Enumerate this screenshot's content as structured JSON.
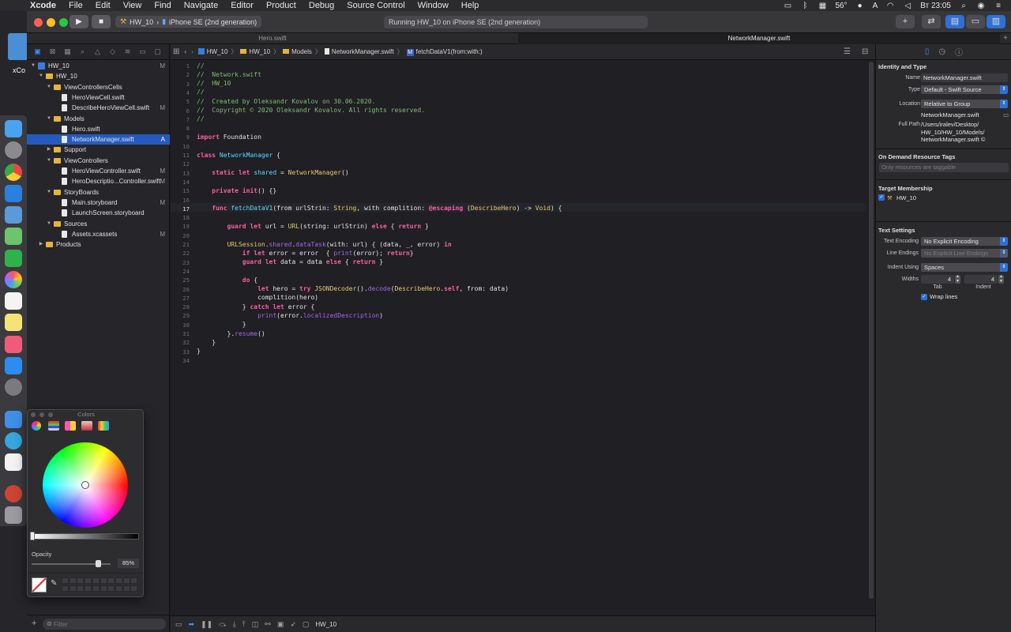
{
  "menubar": {
    "apple": "",
    "items": [
      "Xcode",
      "File",
      "Edit",
      "View",
      "Find",
      "Navigate",
      "Editor",
      "Product",
      "Debug",
      "Source Control",
      "Window",
      "Help"
    ],
    "status": {
      "temperature": "56°",
      "input": "A",
      "clock": "Вт 23:05"
    }
  },
  "desktop": {
    "label": "xCo"
  },
  "toolbar": {
    "run": "▶",
    "stop": "■",
    "scheme_target": "HW_10",
    "scheme_device": "iPhone SE (2nd generation)",
    "activity": "Running HW_10 on iPhone SE (2nd generation)",
    "library": "+",
    "code_review": "⇄"
  },
  "tabs": [
    {
      "label": "Hero.swift",
      "active": false
    },
    {
      "label": "NetworkManager.swift",
      "active": true
    }
  ],
  "navigator": {
    "tree": [
      {
        "label": "HW_10",
        "depth": 0,
        "kind": "proj",
        "open": true,
        "flag": "M"
      },
      {
        "label": "HW_10",
        "depth": 1,
        "kind": "folder",
        "open": true,
        "flag": ""
      },
      {
        "label": "ViewControllersCells",
        "depth": 2,
        "kind": "folder",
        "open": true,
        "flag": ""
      },
      {
        "label": "HeroViewCell.swift",
        "depth": 3,
        "kind": "file",
        "flag": ""
      },
      {
        "label": "DescribeHeroViewCell.swift",
        "depth": 3,
        "kind": "file",
        "flag": "M"
      },
      {
        "label": "Models",
        "depth": 2,
        "kind": "folder",
        "open": true,
        "flag": ""
      },
      {
        "label": "Hero.swift",
        "depth": 3,
        "kind": "file",
        "flag": ""
      },
      {
        "label": "NetworkManager.swift",
        "depth": 3,
        "kind": "file",
        "flag": "A",
        "selected": true
      },
      {
        "label": "Support",
        "depth": 2,
        "kind": "folder",
        "open": false,
        "flag": ""
      },
      {
        "label": "ViewControllers",
        "depth": 2,
        "kind": "folder",
        "open": true,
        "flag": ""
      },
      {
        "label": "HeroViewController.swift",
        "depth": 3,
        "kind": "file",
        "flag": "M"
      },
      {
        "label": "HeroDescriptio...Controller.swift",
        "depth": 3,
        "kind": "file",
        "flag": "M"
      },
      {
        "label": "StoryBoards",
        "depth": 2,
        "kind": "folder",
        "open": true,
        "flag": ""
      },
      {
        "label": "Main.storyboard",
        "depth": 3,
        "kind": "file",
        "flag": "M"
      },
      {
        "label": "LaunchScreen.storyboard",
        "depth": 3,
        "kind": "file",
        "flag": ""
      },
      {
        "label": "Sources",
        "depth": 2,
        "kind": "folder",
        "open": true,
        "flag": ""
      },
      {
        "label": "Assets.xcassets",
        "depth": 3,
        "kind": "file",
        "flag": "M"
      },
      {
        "label": "Products",
        "depth": 1,
        "kind": "folder",
        "open": false,
        "flag": ""
      }
    ],
    "filter_placeholder": "Filter"
  },
  "jumpbar": {
    "crumbs": [
      "HW_10",
      "HW_10",
      "Models",
      "NetworkManager.swift",
      "fetchDataV1(from:with:)"
    ],
    "method_badge": "M"
  },
  "editor": {
    "current_line": 17,
    "lines": [
      [
        [
          "c",
          "//"
        ]
      ],
      [
        [
          "c",
          "//  Network.swift"
        ]
      ],
      [
        [
          "c",
          "//  HW_10"
        ]
      ],
      [
        [
          "c",
          "//"
        ]
      ],
      [
        [
          "c",
          "//  Created by Oleksandr Kovalov on 30.06.2020."
        ]
      ],
      [
        [
          "c",
          "//  Copyright © 2020 Oleksandr Kovalov. All rights reserved."
        ]
      ],
      [
        [
          "c",
          "//"
        ]
      ],
      [],
      [
        [
          "k",
          "import"
        ],
        [
          "p",
          " Foundation"
        ]
      ],
      [],
      [
        [
          "k",
          "class"
        ],
        [
          "p",
          " "
        ],
        [
          "n",
          "NetworkManager"
        ],
        [
          "p",
          " {"
        ]
      ],
      [],
      [
        [
          "p",
          "    "
        ],
        [
          "k",
          "static"
        ],
        [
          "p",
          " "
        ],
        [
          "k",
          "let"
        ],
        [
          "p",
          " "
        ],
        [
          "n",
          "shared"
        ],
        [
          "p",
          " = "
        ],
        [
          "y",
          "NetworkManager"
        ],
        [
          "p",
          "()"
        ]
      ],
      [],
      [
        [
          "p",
          "    "
        ],
        [
          "k",
          "private"
        ],
        [
          "p",
          " "
        ],
        [
          "k",
          "init"
        ],
        [
          "p",
          "() {}"
        ]
      ],
      [],
      [
        [
          "p",
          "    "
        ],
        [
          "k",
          "func"
        ],
        [
          "p",
          " "
        ],
        [
          "n",
          "fetchDataV1"
        ],
        [
          "p",
          "(from urlStrin: "
        ],
        [
          "y",
          "String"
        ],
        [
          "p",
          ", with complition: "
        ],
        [
          "a",
          "@escaping"
        ],
        [
          "p",
          " ("
        ],
        [
          "y",
          "DescribeHero"
        ],
        [
          "p",
          ") -> "
        ],
        [
          "y",
          "Void"
        ],
        [
          "p",
          ") {"
        ]
      ],
      [],
      [
        [
          "p",
          "        "
        ],
        [
          "k",
          "guard"
        ],
        [
          "p",
          " "
        ],
        [
          "k",
          "let"
        ],
        [
          "p",
          " url = "
        ],
        [
          "y",
          "URL"
        ],
        [
          "p",
          "(string: urlStrin) "
        ],
        [
          "k",
          "else"
        ],
        [
          "p",
          " { "
        ],
        [
          "k",
          "return"
        ],
        [
          "p",
          " }"
        ]
      ],
      [],
      [
        [
          "p",
          "        "
        ],
        [
          "y",
          "URLSession"
        ],
        [
          "p",
          "."
        ],
        [
          "f",
          "shared"
        ],
        [
          "p",
          "."
        ],
        [
          "f",
          "dataTask"
        ],
        [
          "p",
          "(with: url) { (data, _, error) "
        ],
        [
          "k",
          "in"
        ]
      ],
      [
        [
          "p",
          "            "
        ],
        [
          "k",
          "if"
        ],
        [
          "p",
          " "
        ],
        [
          "k",
          "let"
        ],
        [
          "p",
          " error = error  { "
        ],
        [
          "f",
          "print"
        ],
        [
          "p",
          "(error); "
        ],
        [
          "k",
          "return"
        ],
        [
          "p",
          "}"
        ]
      ],
      [
        [
          "p",
          "            "
        ],
        [
          "k",
          "guard"
        ],
        [
          "p",
          " "
        ],
        [
          "k",
          "let"
        ],
        [
          "p",
          " data = data "
        ],
        [
          "k",
          "else"
        ],
        [
          "p",
          " { "
        ],
        [
          "k",
          "return"
        ],
        [
          "p",
          " }"
        ]
      ],
      [],
      [
        [
          "p",
          "            "
        ],
        [
          "k",
          "do"
        ],
        [
          "p",
          " {"
        ]
      ],
      [
        [
          "p",
          "                "
        ],
        [
          "k",
          "let"
        ],
        [
          "p",
          " hero = "
        ],
        [
          "k",
          "try"
        ],
        [
          "p",
          " "
        ],
        [
          "y",
          "JSONDecoder"
        ],
        [
          "p",
          "()."
        ],
        [
          "f",
          "decode"
        ],
        [
          "p",
          "("
        ],
        [
          "y",
          "DescribeHero"
        ],
        [
          "p",
          "."
        ],
        [
          "k",
          "self"
        ],
        [
          "p",
          ", from: data)"
        ]
      ],
      [
        [
          "p",
          "                complition(hero)"
        ]
      ],
      [
        [
          "p",
          "            } "
        ],
        [
          "k",
          "catch"
        ],
        [
          "p",
          " "
        ],
        [
          "k",
          "let"
        ],
        [
          "p",
          " error {"
        ]
      ],
      [
        [
          "p",
          "                "
        ],
        [
          "f",
          "print"
        ],
        [
          "p",
          "(error."
        ],
        [
          "f",
          "localizedDescription"
        ],
        [
          "p",
          ")"
        ]
      ],
      [
        [
          "p",
          "            }"
        ]
      ],
      [
        [
          "p",
          "        }."
        ],
        [
          "f",
          "resume"
        ],
        [
          "p",
          "()"
        ]
      ],
      [
        [
          "p",
          "    }"
        ]
      ],
      [
        [
          "p",
          "}"
        ]
      ],
      []
    ]
  },
  "debugbar": {
    "scheme": "HW_10"
  },
  "inspector": {
    "identity_title": "Identity and Type",
    "name_label": "Name",
    "name_value": "NetworkManager.swift",
    "type_label": "Type",
    "type_value": "Default - Swift Source",
    "location_label": "Location",
    "location_value": "Relative to Group",
    "location_file": "NetworkManager.swift",
    "fullpath_label": "Full Path",
    "fullpath_lines": [
      "/Users/iralev/Desktop/",
      "HW_10/HW_10/Models/",
      "NetworkManager.swift ©"
    ],
    "ondemand_title": "On Demand Resource Tags",
    "ondemand_placeholder": "Only resources are taggable",
    "target_title": "Target Membership",
    "target_name": "HW_10",
    "text_title": "Text Settings",
    "encoding_label": "Text Encoding",
    "encoding_value": "No Explicit Encoding",
    "endings_label": "Line Endings",
    "endings_value": "No Explicit Line Endings",
    "indent_label": "Indent Using",
    "indent_value": "Spaces",
    "widths_label": "Widths",
    "tab_width": "4",
    "indent_width": "4",
    "tab_caption": "Tab",
    "indent_caption": "Indent",
    "wrap_label": "Wrap lines"
  },
  "colors_panel": {
    "title": "Colors",
    "opacity_label": "Opacity",
    "opacity_value": "85%"
  },
  "colors": {
    "accent": "#245ac0",
    "keyword": "#fc5fa3",
    "comment": "#7fc06b"
  }
}
